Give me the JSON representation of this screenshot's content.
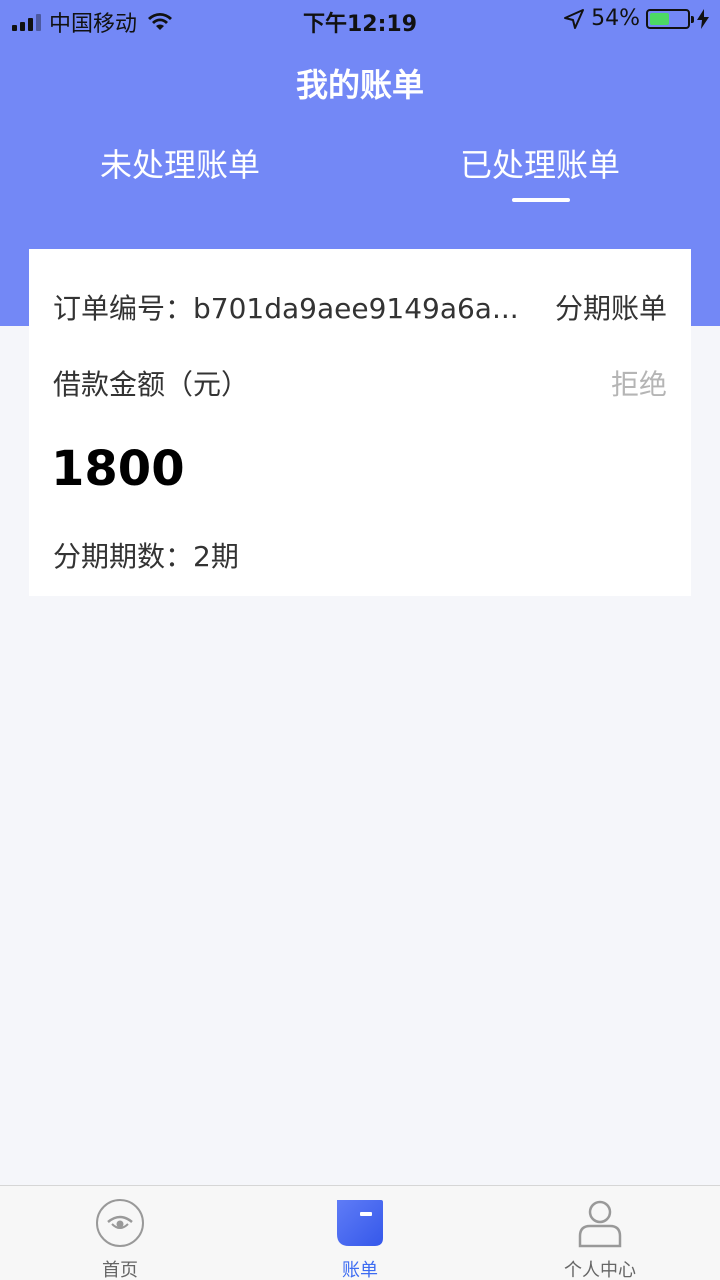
{
  "status_bar": {
    "carrier": "中国移动",
    "time": "下午12:19",
    "battery": "54%",
    "battery_level": 0.54
  },
  "header": {
    "title": "我的账单",
    "tabs": [
      {
        "label": "未处理账单",
        "active": false
      },
      {
        "label": "已处理账单",
        "active": true
      }
    ]
  },
  "bill": {
    "order_no": "订单编号：b701da9aee9149a6a...",
    "type": "分期账单",
    "amount_label": "借款金额（元）",
    "status": "拒绝",
    "amount": "1800",
    "periods": "分期期数：2期"
  },
  "bottom_nav": {
    "items": [
      {
        "label": "首页",
        "icon": "home-eye-icon",
        "active": false
      },
      {
        "label": "账单",
        "icon": "bill-icon",
        "active": true
      },
      {
        "label": "个人中心",
        "icon": "person-icon",
        "active": false
      }
    ]
  },
  "colors": {
    "header_bg": "#7388f6",
    "active_nav": "#3d6cf2",
    "status_gray": "#b5b5b5"
  }
}
